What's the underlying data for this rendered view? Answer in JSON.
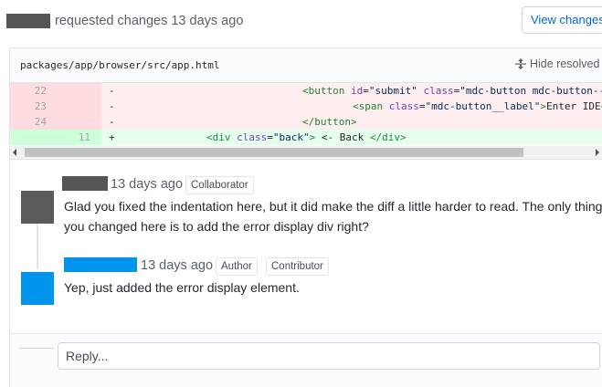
{
  "header": {
    "action_text": "requested changes 13 days ago",
    "view_changes_label": "View changes"
  },
  "file": {
    "path": "packages/app/browser/src/app.html",
    "hide_resolved_label": "Hide resolved",
    "hide_resolved_icon": "unfold-icon"
  },
  "diff": {
    "rows": [
      {
        "type": "del",
        "old": "22",
        "new": "",
        "sign": "-",
        "indent": "<button",
        "code": [
          {
            "t": "tag",
            "v": "<button "
          },
          {
            "t": "attr",
            "v": "id"
          },
          {
            "t": "",
            "v": "="
          },
          {
            "t": "str",
            "v": "\"submit\""
          },
          {
            "t": "",
            "v": " "
          },
          {
            "t": "attr",
            "v": "class"
          },
          {
            "t": "",
            "v": "="
          },
          {
            "t": "str",
            "v": "\"mdc-button mdc-button--"
          }
        ]
      },
      {
        "type": "del",
        "old": "23",
        "new": "",
        "sign": "-",
        "code": [
          {
            "t": "tag",
            "v": "<span "
          },
          {
            "t": "attr",
            "v": "class"
          },
          {
            "t": "",
            "v": "="
          },
          {
            "t": "str",
            "v": "\"mdc-button__label\""
          },
          {
            "t": "tag",
            "v": ">"
          },
          {
            "t": "",
            "v": "Enter IDE"
          },
          {
            "t": "tag",
            "v": "<"
          }
        ]
      },
      {
        "type": "del",
        "old": "24",
        "new": "",
        "sign": "-",
        "code": [
          {
            "t": "tag",
            "v": "</button>"
          }
        ]
      },
      {
        "type": "add",
        "old": "",
        "new": "11",
        "sign": "+",
        "code": [
          {
            "t": "tag",
            "v": "<div "
          },
          {
            "t": "attr",
            "v": "class"
          },
          {
            "t": "",
            "v": "="
          },
          {
            "t": "str",
            "v": "\"back\""
          },
          {
            "t": "tag",
            "v": ">"
          },
          {
            "t": "",
            "v": " <- Back "
          },
          {
            "t": "tag",
            "v": "</div>"
          }
        ]
      }
    ]
  },
  "comments": [
    {
      "time": "13 days ago",
      "badges": [
        "Collaborator"
      ],
      "body": "Glad you fixed the indentation here, but it did make the diff a little harder to read. The only thing you changed here is to add the error display div right?"
    },
    {
      "time": "13 days ago",
      "badges": [
        "Author",
        "Contributor"
      ],
      "body": "Yep, just added the error display element."
    }
  ],
  "reply": {
    "placeholder": "Reply..."
  }
}
